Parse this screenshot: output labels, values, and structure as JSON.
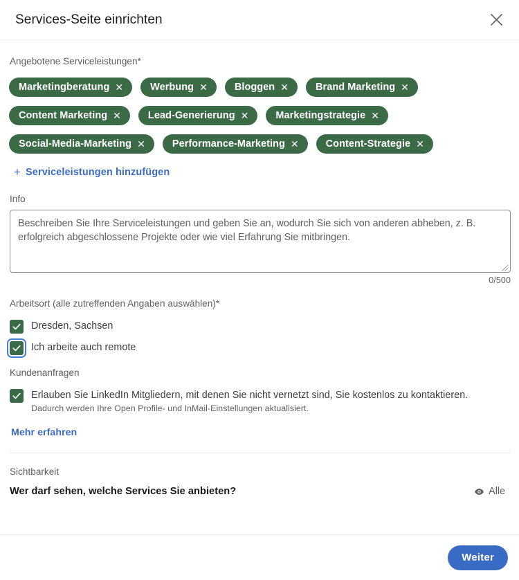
{
  "dialog": {
    "title": "Services-Seite einrichten",
    "close_icon": "close-icon"
  },
  "services": {
    "label": "Angebotene Serviceleistungen*",
    "chips": [
      {
        "label": "Marketingberatung",
        "remove": "✕"
      },
      {
        "label": "Werbung",
        "remove": "✕"
      },
      {
        "label": "Bloggen",
        "remove": "✕"
      },
      {
        "label": "Brand Marketing",
        "remove": "✕"
      },
      {
        "label": "Content Marketing",
        "remove": "✕"
      },
      {
        "label": "Lead-Generierung",
        "remove": "✕"
      },
      {
        "label": "Marketingstrategie",
        "remove": "✕"
      },
      {
        "label": "Social-Media-Marketing",
        "remove": "✕"
      },
      {
        "label": "Performance-Marketing",
        "remove": "✕"
      },
      {
        "label": "Content-Strategie",
        "remove": "✕"
      }
    ],
    "add_link": "Serviceleistungen hinzufügen",
    "add_icon": "plus-icon",
    "chip_color": "#3b6b46"
  },
  "info": {
    "label": "Info",
    "value": "",
    "placeholder": "Beschreiben Sie Ihre Serviceleistungen und geben Sie an, wodurch Sie sich von anderen abheben, z. B. erfolgreich abgeschlossene Projekte oder wie viel Erfahrung Sie mitbringen.",
    "counter": "0/500"
  },
  "worklocation": {
    "label": "Arbeitsort (alle zutreffenden Angaben auswählen)*",
    "options": [
      {
        "label": "Dresden, Sachsen",
        "checked": true,
        "focused": false
      },
      {
        "label": "Ich arbeite auch remote",
        "checked": true,
        "focused": true
      }
    ]
  },
  "inquiries": {
    "label": "Kundenanfragen",
    "option": {
      "label": "Erlauben Sie LinkedIn Mitgliedern, mit denen Sie nicht vernetzt sind, Sie kostenlos zu kontaktieren.",
      "sub": "Dadurch werden Ihre Open Profile- und InMail-Einstellungen aktualisiert.",
      "checked": true
    },
    "more_link": "Mehr erfahren"
  },
  "visibility": {
    "label": "Sichtbarkeit",
    "question": "Wer darf sehen, welche Services Sie anbieten?",
    "value": "Alle",
    "value_icon": "eye-icon"
  },
  "footer": {
    "next_label": "Weiter",
    "accent_color": "#3a6bc4"
  }
}
